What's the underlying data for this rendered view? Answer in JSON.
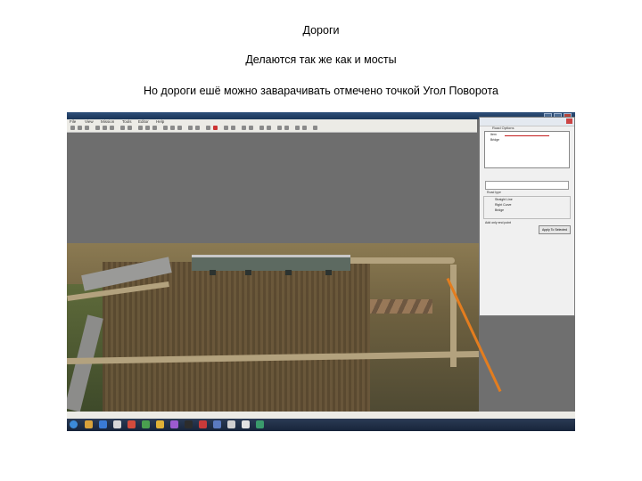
{
  "captions": {
    "line1": "Дороги",
    "line2": "Делаются так же как и мосты",
    "line3": "Но дороги ешё можно заварачивать отмечено точкой Угол Поворота"
  },
  "app": {
    "title": "",
    "menu": [
      "File",
      "View",
      "Mission",
      "Tools",
      "Editor",
      "Help"
    ],
    "status": "",
    "tray_time": ""
  },
  "panel": {
    "title": "Road Options",
    "list_items": [
      "Item",
      "Bridge"
    ],
    "group_label": "Road type",
    "options": [
      "Straight Line",
      "Right Curve",
      "Bridge"
    ],
    "checkbox_label": "Add only end point",
    "apply_label": "Apply To Selected"
  },
  "colors": {
    "accent": "#e37d1f",
    "titlebar": "#1b3557",
    "taskbar": "#17243a"
  }
}
